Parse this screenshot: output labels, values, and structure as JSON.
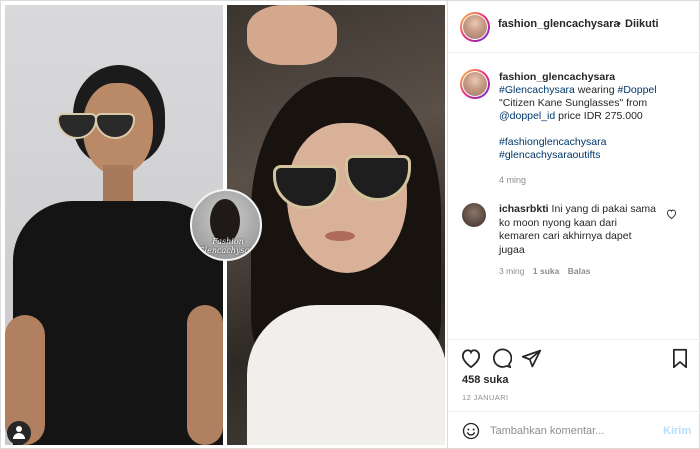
{
  "post": {
    "watermark_line1": "Fashion",
    "watermark_line2": "Glencachysara"
  },
  "header": {
    "username": "fashion_glencachysara",
    "separator": "•",
    "follow_label": "Diikuti"
  },
  "caption": {
    "username": "fashion_glencachysara",
    "tag1": "#Glencachysara",
    "text1": " wearing ",
    "tag2": "#Doppel",
    "text2": " \"Citizen Kane Sunglasses\" from ",
    "mention": "@doppel_id",
    "text3": " price IDR 275.000",
    "hashtag_a": "#fashionglencachysara",
    "hashtag_b": "#glencachysaraoutifts",
    "time": "4 ming"
  },
  "comment": {
    "username": "ichasrbkti",
    "text": " Ini yang di pakai sama ko moon nyong kaan dari kemaren cari akhirnya dapet jugaa",
    "time": "3 ming",
    "likes": "1 suka",
    "reply": "Balas"
  },
  "actions": {
    "like_icon": "heart-icon",
    "comment_icon": "comment-icon",
    "share_icon": "share-icon",
    "save_icon": "bookmark-icon"
  },
  "likes_count": "458 suka",
  "date": "12 JANUARI",
  "comment_bar": {
    "placeholder": "Tambahkan komentar...",
    "send_label": "Kirim"
  }
}
